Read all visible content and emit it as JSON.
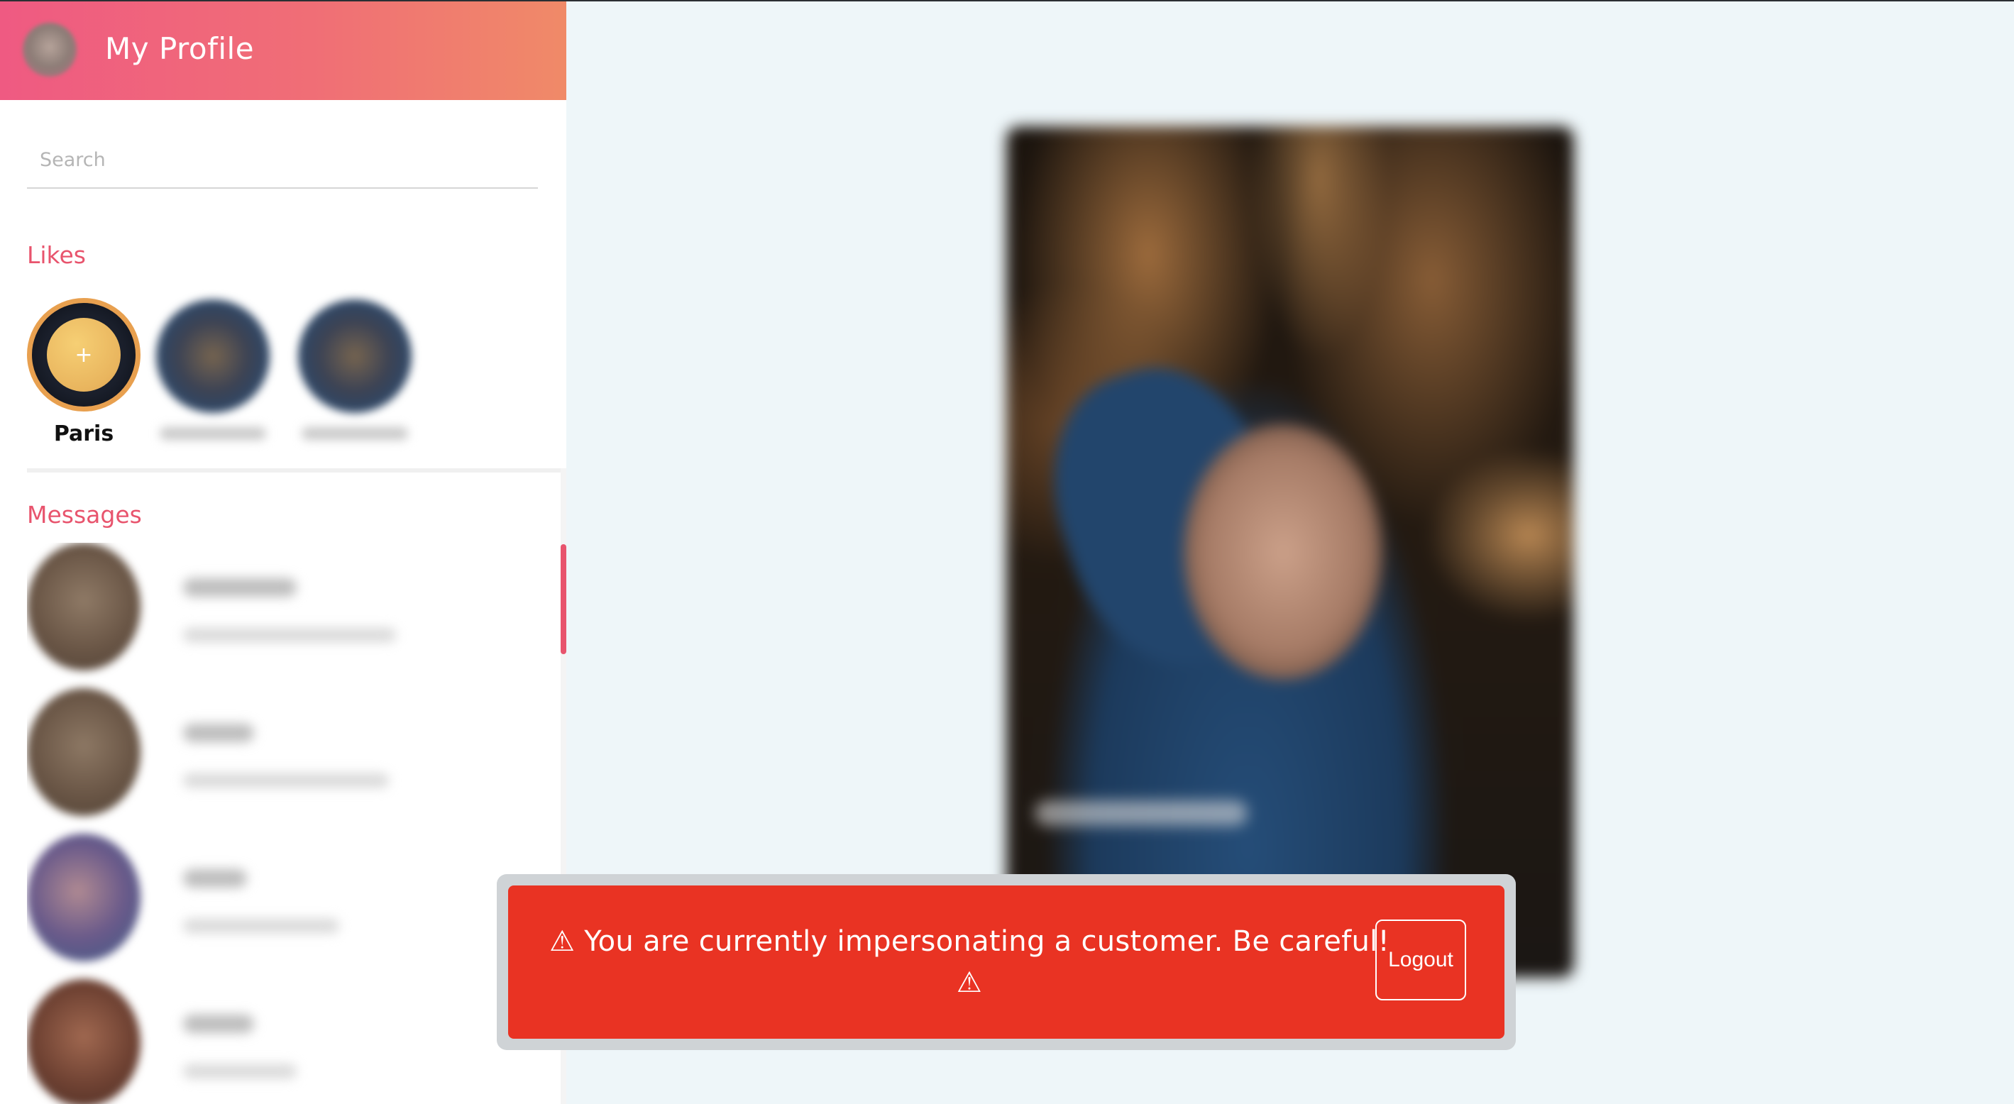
{
  "header": {
    "title": "My Profile",
    "avatar_icon": "user-avatar-icon"
  },
  "search": {
    "placeholder": "Search",
    "value": ""
  },
  "likes": {
    "title": "Likes",
    "items": [
      {
        "name": "Paris",
        "icon": "plus-icon",
        "symbol": "+"
      },
      {
        "name": ""
      },
      {
        "name": ""
      }
    ]
  },
  "messages": {
    "title": "Messages",
    "items": [
      {
        "name": "",
        "preview": ""
      },
      {
        "name": "",
        "preview": ""
      },
      {
        "name": "",
        "preview": ""
      },
      {
        "name": "",
        "preview": ""
      }
    ]
  },
  "banner": {
    "text": "⚠ You are currently impersonating a customer. Be careful! ⚠",
    "logout_label": "Logout",
    "color": "#e93323"
  },
  "colors": {
    "accent": "#e8546d",
    "header_gradient_start": "#ef5a82",
    "header_gradient_end": "#f08a68",
    "gold_ring": "#e8a04f"
  }
}
